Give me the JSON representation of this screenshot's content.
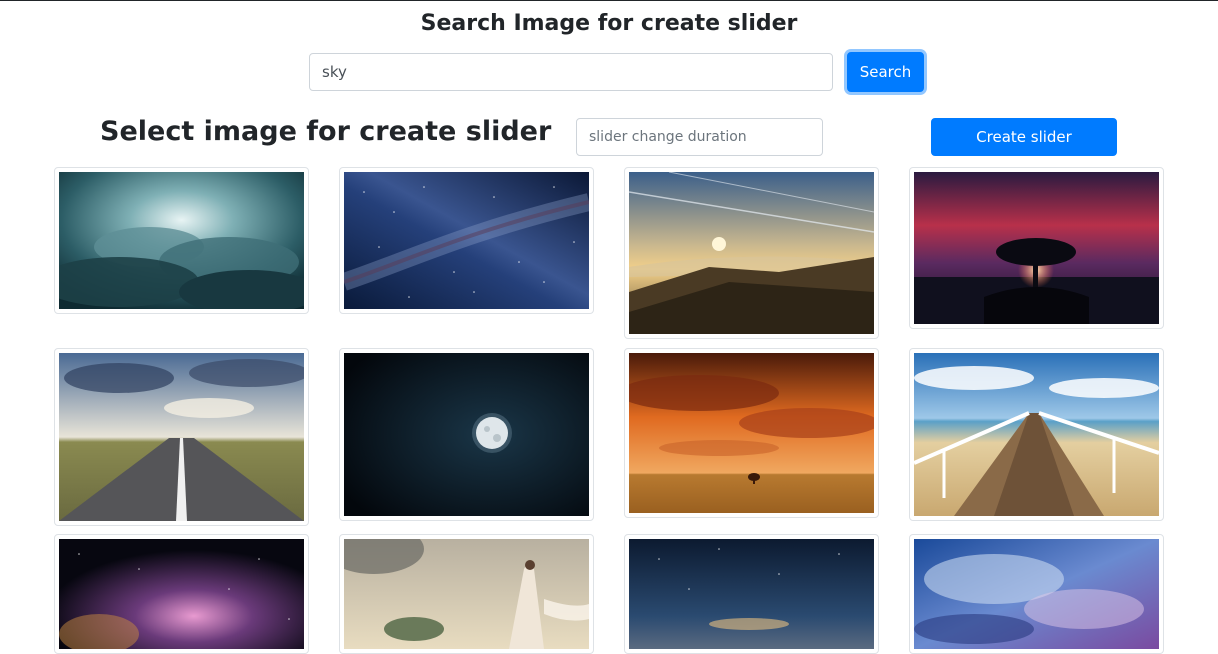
{
  "header": {
    "title": "Search Image for create slider",
    "search_value": "sky",
    "search_button": "Search"
  },
  "slider": {
    "title": "Select image for create slider",
    "duration_placeholder": "slider change duration",
    "create_button": "Create slider"
  },
  "images": [
    {
      "name": "cloud-burst-teal"
    },
    {
      "name": "milky-way-blue"
    },
    {
      "name": "sunset-mountain-clouds"
    },
    {
      "name": "tree-red-sky"
    },
    {
      "name": "road-to-horizon"
    },
    {
      "name": "full-moon-night"
    },
    {
      "name": "orange-sky-lone-tree"
    },
    {
      "name": "pier-beach-sky"
    },
    {
      "name": "galaxy-purple-glow"
    },
    {
      "name": "fantasy-woman-floating-island"
    },
    {
      "name": "night-sky-horizon"
    },
    {
      "name": "blue-storm-clouds"
    }
  ]
}
